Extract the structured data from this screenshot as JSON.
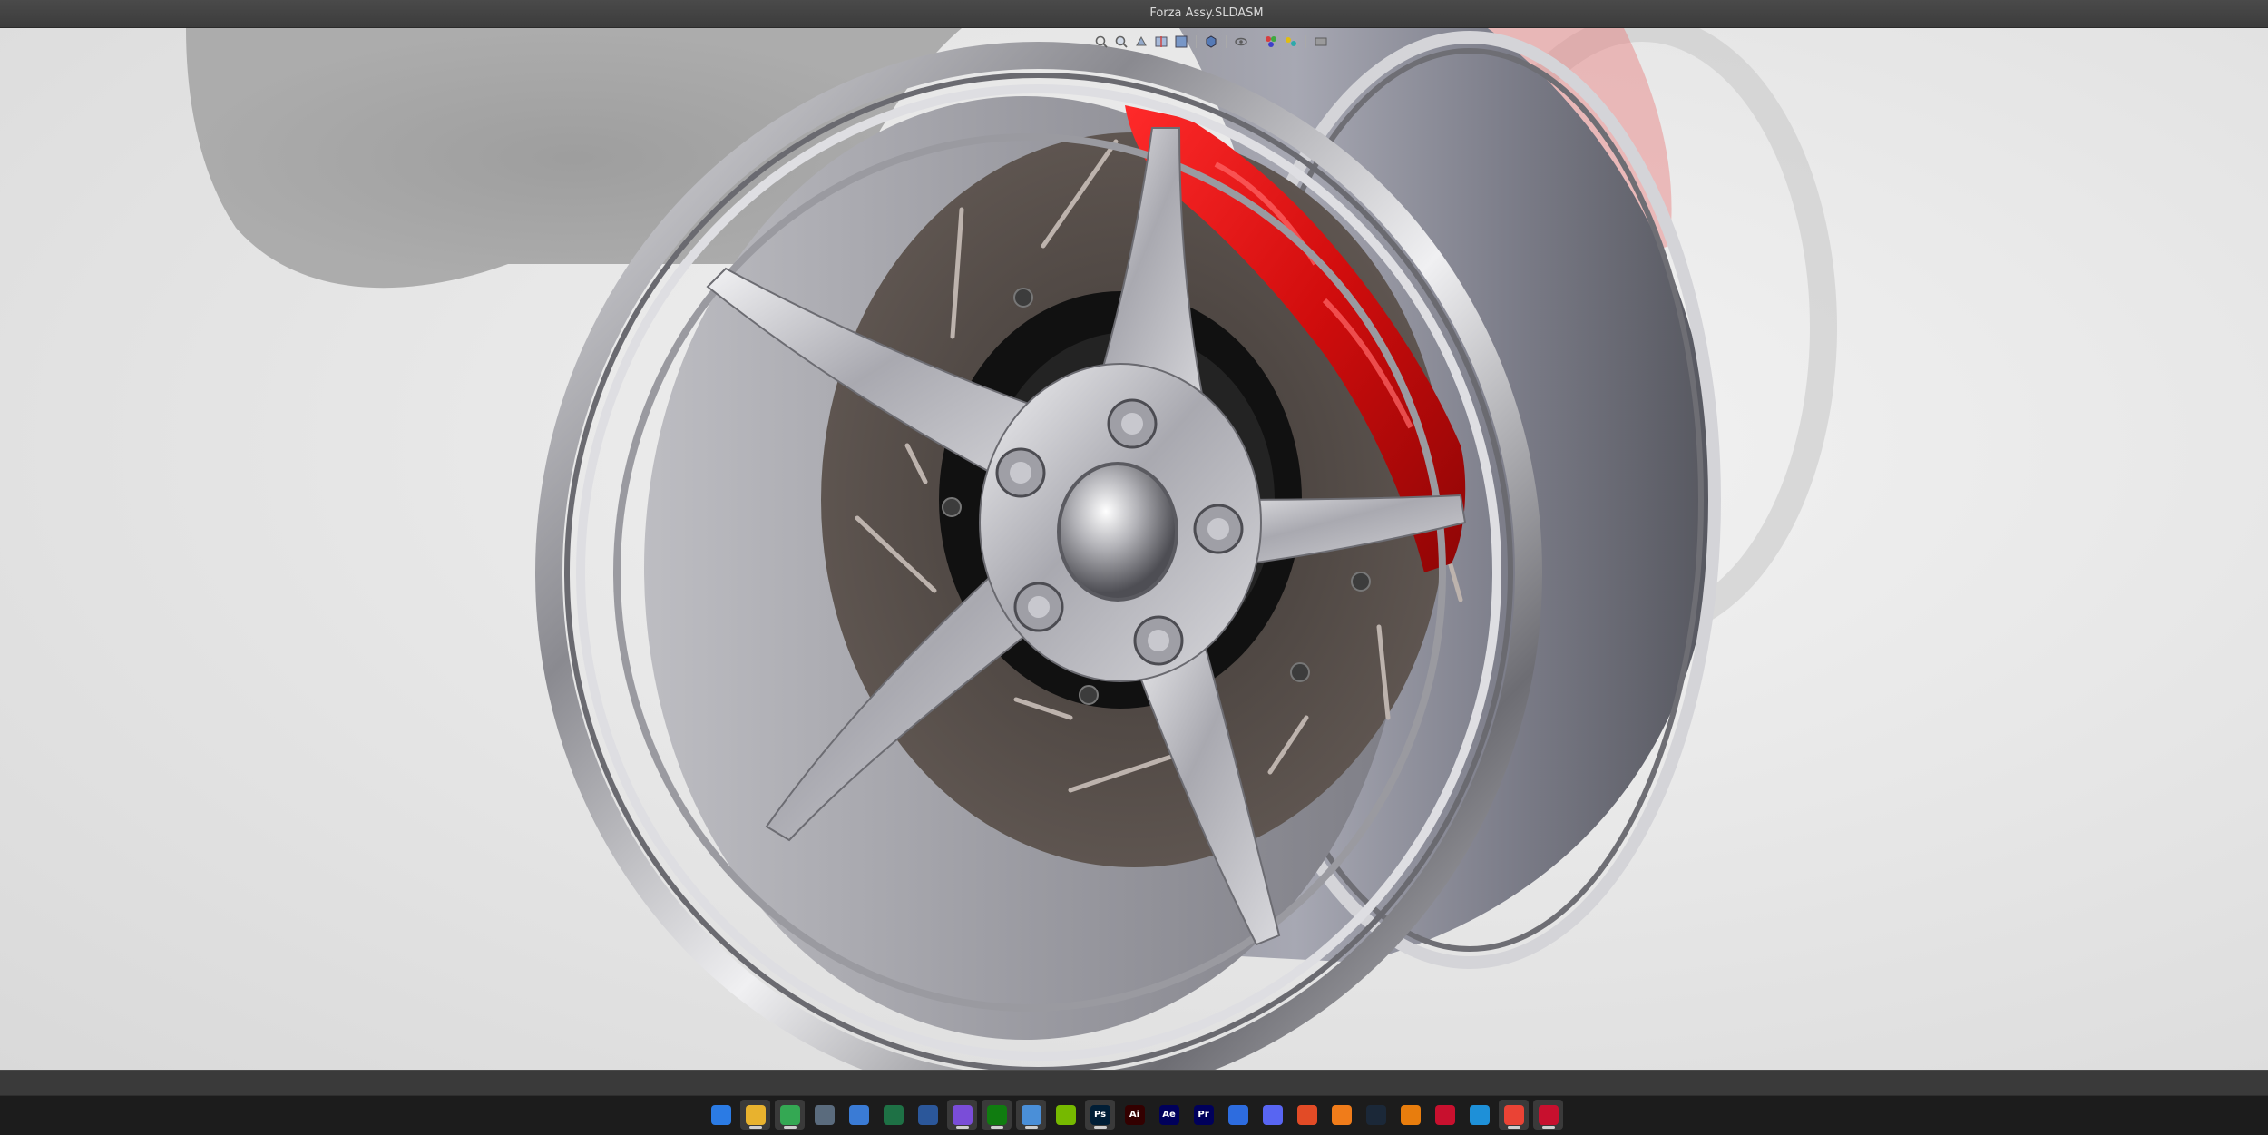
{
  "window": {
    "title": "Forza Assy.SLDASM"
  },
  "heads_up_toolbar": {
    "buttons": [
      {
        "name": "zoom-to-fit-icon"
      },
      {
        "name": "zoom-to-area-icon"
      },
      {
        "name": "previous-view-icon"
      },
      {
        "name": "section-view-icon"
      },
      {
        "name": "view-orientation-icon"
      },
      {
        "name": "display-style-icon"
      },
      {
        "name": "hide-show-items-icon"
      },
      {
        "name": "edit-appearance-icon"
      },
      {
        "name": "apply-scene-icon"
      },
      {
        "name": "view-settings-icon"
      }
    ]
  },
  "colors": {
    "caliper_red": "#d10d0d",
    "rim_silver": "#b9b9bf",
    "rotor_gray": "#5b534f",
    "hub_black": "#0e0e0e",
    "viewport_bg": "#e6e6e6",
    "taskbar_bg": "#1c1c1c"
  },
  "taskbar": {
    "icons": [
      {
        "name": "windows-start-icon",
        "label": "",
        "color": "#2b7be4",
        "active": false
      },
      {
        "name": "file-explorer-icon",
        "label": "",
        "color": "#e8b22e",
        "active": true
      },
      {
        "name": "chrome-icon",
        "label": "",
        "color": "#34a853",
        "active": true
      },
      {
        "name": "calculator-icon",
        "label": "",
        "color": "#5a6b7d",
        "active": false
      },
      {
        "name": "microsoft-store-icon",
        "label": "",
        "color": "#3a7bd5",
        "active": false
      },
      {
        "name": "excel-icon",
        "label": "",
        "color": "#1e7145",
        "active": false
      },
      {
        "name": "word-icon",
        "label": "",
        "color": "#2b579a",
        "active": false
      },
      {
        "name": "camera-app-icon",
        "label": "",
        "color": "#7a4dd8",
        "active": true
      },
      {
        "name": "xbox-icon",
        "label": "",
        "color": "#107c10",
        "active": true
      },
      {
        "name": "notepad-icon",
        "label": "",
        "color": "#4a8fd8",
        "active": true
      },
      {
        "name": "nvidia-icon",
        "label": "",
        "color": "#76b900",
        "active": false
      },
      {
        "name": "photoshop-icon",
        "label": "Ps",
        "color": "#001e36",
        "active": true
      },
      {
        "name": "illustrator-icon",
        "label": "Ai",
        "color": "#330000",
        "active": false
      },
      {
        "name": "after-effects-icon",
        "label": "Ae",
        "color": "#00005b",
        "active": false
      },
      {
        "name": "premiere-pro-icon",
        "label": "Pr",
        "color": "#00005b",
        "active": false
      },
      {
        "name": "mail-icon",
        "label": "",
        "color": "#2d6cdf",
        "active": false
      },
      {
        "name": "discord-icon",
        "label": "",
        "color": "#5865f2",
        "active": false
      },
      {
        "name": "ea-icon",
        "label": "",
        "color": "#e24b26",
        "active": false
      },
      {
        "name": "fusion-icon",
        "label": "",
        "color": "#f07c1a",
        "active": false
      },
      {
        "name": "steam-icon",
        "label": "",
        "color": "#1b2838",
        "active": false
      },
      {
        "name": "blender-icon",
        "label": "",
        "color": "#e87d0d",
        "active": false
      },
      {
        "name": "solidworks-icon",
        "label": "",
        "color": "#c8102e",
        "active": false
      },
      {
        "name": "3d-cube-icon",
        "label": "",
        "color": "#1e90d8",
        "active": false
      },
      {
        "name": "chrome-profile-icon",
        "label": "",
        "color": "#ea4335",
        "active": true
      },
      {
        "name": "solidworks-active-icon",
        "label": "",
        "color": "#c8102e",
        "active": true
      }
    ]
  }
}
